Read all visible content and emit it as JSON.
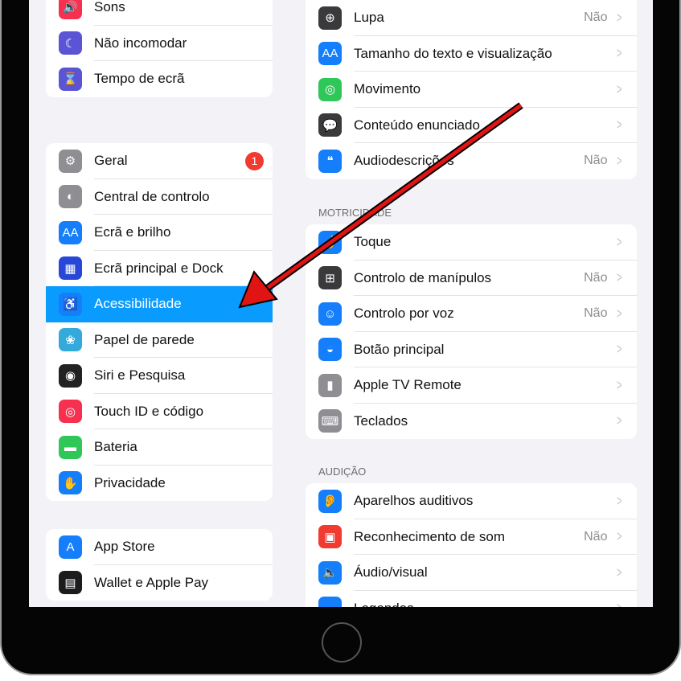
{
  "left": {
    "groups": [
      [
        {
          "label": "Sons",
          "icon": "speaker-icon",
          "color": "#f8304f",
          "glyph": "🔊"
        },
        {
          "label": "Não incomodar",
          "icon": "moon-icon",
          "color": "#5b55d6",
          "glyph": "☾"
        },
        {
          "label": "Tempo de ecrã",
          "icon": "hourglass-icon",
          "color": "#5b55d6",
          "glyph": "⌛"
        }
      ],
      [
        {
          "label": "Geral",
          "icon": "gear-icon",
          "color": "#8e8e93",
          "glyph": "⚙",
          "badge": "1"
        },
        {
          "label": "Central de controlo",
          "icon": "toggles-icon",
          "color": "#8e8e93",
          "glyph": "◐"
        },
        {
          "label": "Ecrã e brilho",
          "icon": "text-size-icon",
          "color": "#147efb",
          "glyph": "AA"
        },
        {
          "label": "Ecrã principal e Dock",
          "icon": "home-grid-icon",
          "color": "#2747d8",
          "glyph": "▦"
        },
        {
          "label": "Acessibilidade",
          "icon": "accessibility-icon",
          "color": "#147efb",
          "glyph": "♿",
          "selected": true
        },
        {
          "label": "Papel de parede",
          "icon": "flower-icon",
          "color": "#34aadc",
          "glyph": "❀"
        },
        {
          "label": "Siri e Pesquisa",
          "icon": "siri-icon",
          "color": "#222",
          "glyph": "◉"
        },
        {
          "label": "Touch ID e código",
          "icon": "fingerprint-icon",
          "color": "#f8304f",
          "glyph": "◎"
        },
        {
          "label": "Bateria",
          "icon": "battery-icon",
          "color": "#30c759",
          "glyph": "▬"
        },
        {
          "label": "Privacidade",
          "icon": "hand-icon",
          "color": "#147efb",
          "glyph": "✋"
        }
      ],
      [
        {
          "label": "App Store",
          "icon": "app-store-icon",
          "color": "#147efb",
          "glyph": "A"
        },
        {
          "label": "Wallet e Apple Pay",
          "icon": "wallet-icon",
          "color": "#1c1c1e",
          "glyph": "▤"
        }
      ]
    ]
  },
  "right": {
    "sections": [
      {
        "header": "",
        "rows": [
          {
            "label": "Lupa",
            "value": "Não",
            "icon": "magnifier-icon",
            "color": "#3a3a3c",
            "glyph": "⊕"
          },
          {
            "label": "Tamanho do texto e visualização",
            "value": "",
            "icon": "text-size-icon",
            "color": "#147efb",
            "glyph": "AA"
          },
          {
            "label": "Movimento",
            "value": "",
            "icon": "motion-icon",
            "color": "#30c759",
            "glyph": "◎"
          },
          {
            "label": "Conteúdo enunciado",
            "value": "",
            "icon": "speech-bubble-icon",
            "color": "#3a3a3c",
            "glyph": "💬"
          },
          {
            "label": "Audiodescrições",
            "value": "Não",
            "icon": "quote-bubble-icon",
            "color": "#147efb",
            "glyph": "❝"
          }
        ]
      },
      {
        "header": "MOTRICIDADE",
        "rows": [
          {
            "label": "Toque",
            "value": "",
            "icon": "touch-icon",
            "color": "#147efb",
            "glyph": "☝"
          },
          {
            "label": "Controlo de manípulos",
            "value": "Não",
            "icon": "grid-icon",
            "color": "#3a3a3c",
            "glyph": "⊞"
          },
          {
            "label": "Controlo por voz",
            "value": "Não",
            "icon": "voice-control-icon",
            "color": "#147efb",
            "glyph": "☺"
          },
          {
            "label": "Botão principal",
            "value": "",
            "icon": "home-button-icon",
            "color": "#147efb",
            "glyph": "◒"
          },
          {
            "label": "Apple TV Remote",
            "value": "",
            "icon": "remote-icon",
            "color": "#8e8e93",
            "glyph": "▮"
          },
          {
            "label": "Teclados",
            "value": "",
            "icon": "keyboard-icon",
            "color": "#8e8e93",
            "glyph": "⌨"
          }
        ]
      },
      {
        "header": "AUDIÇÃO",
        "rows": [
          {
            "label": "Aparelhos auditivos",
            "value": "",
            "icon": "ear-icon",
            "color": "#147efb",
            "glyph": "👂"
          },
          {
            "label": "Reconhecimento de som",
            "value": "Não",
            "icon": "sound-recognition-icon",
            "color": "#f13a30",
            "glyph": "▣"
          },
          {
            "label": "Áudio/visual",
            "value": "",
            "icon": "audio-visual-icon",
            "color": "#147efb",
            "glyph": "🔈"
          },
          {
            "label": "Legendas",
            "value": "",
            "icon": "captions-icon",
            "color": "#147efb",
            "glyph": "▭"
          }
        ]
      }
    ]
  },
  "annotation": {
    "arrow_color": "#e11414"
  }
}
